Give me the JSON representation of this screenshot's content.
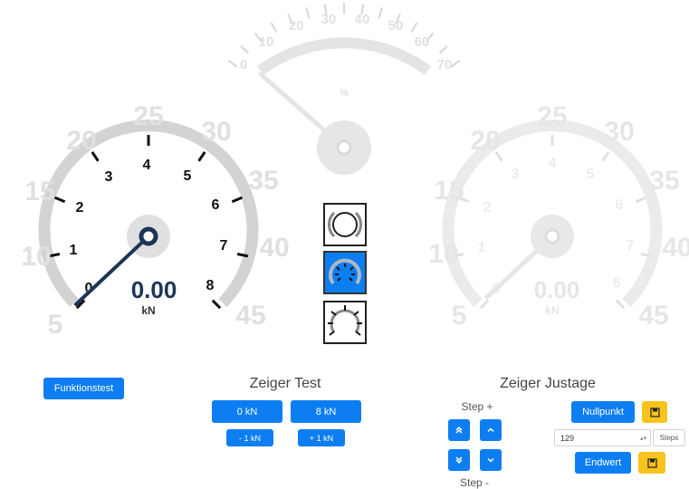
{
  "gauges": {
    "left": {
      "outer_scale": [
        "5",
        "10",
        "15",
        "20",
        "25",
        "30",
        "35",
        "40",
        "45"
      ],
      "inner_scale": [
        "0",
        "1",
        "2",
        "3",
        "4",
        "5",
        "6",
        "7",
        "8"
      ],
      "value": "0.00",
      "unit": "kN"
    },
    "top": {
      "scale": [
        "0",
        "10",
        "20",
        "30",
        "40",
        "50",
        "60",
        "70"
      ],
      "unit": "%"
    },
    "right": {
      "outer_scale": [
        "5",
        "10",
        "15",
        "20",
        "25",
        "30",
        "35",
        "40",
        "45"
      ],
      "inner_scale": [
        "0",
        "1",
        "2",
        "3",
        "4",
        "5",
        "6",
        "7",
        "8"
      ],
      "value": "0.00",
      "unit": "kN"
    }
  },
  "mode_buttons": [
    {
      "icon": "ring-icon",
      "active": false
    },
    {
      "icon": "dial-gauge-icon",
      "active": true
    },
    {
      "icon": "dial-ticks-icon",
      "active": false
    }
  ],
  "funktionstest": {
    "label": "Funktionstest"
  },
  "zeiger_test": {
    "heading": "Zeiger Test",
    "btn_0kn": "0 kN",
    "btn_8kn": "8 kN",
    "btn_minus1": "- 1 kN",
    "btn_plus1": "+ 1 kN"
  },
  "zeiger_justage": {
    "heading": "Zeiger Justage",
    "step_plus": "Step +",
    "step_minus": "Step -",
    "nullpunkt": "Nullpunkt",
    "endwert": "Endwert",
    "steps_value": "129",
    "steps_unit": "Steps"
  },
  "colors": {
    "accent": "#0d7ef2",
    "save": "#f7c31c",
    "needle": "#1c3557",
    "track": "#d3d3d3"
  }
}
